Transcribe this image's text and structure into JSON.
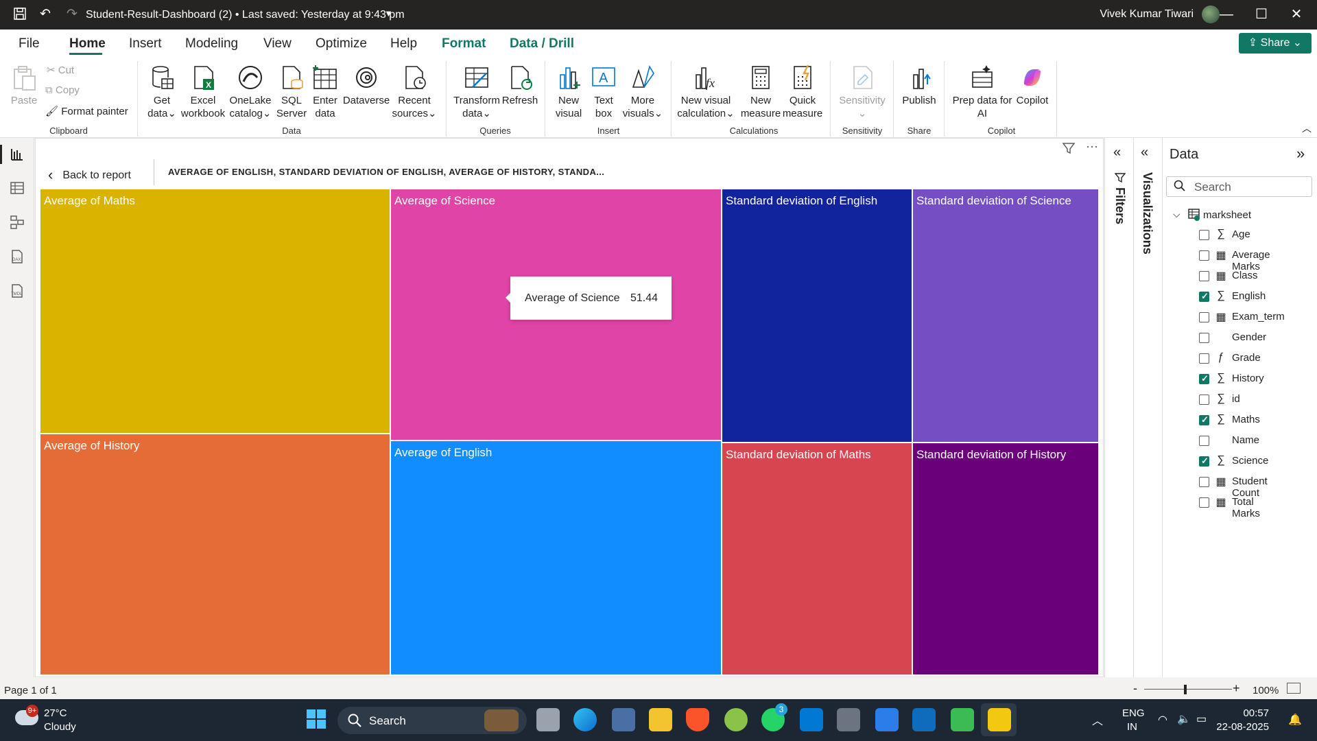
{
  "titlebar": {
    "title": "Student-Result-Dashboard (2) • Last saved: Yesterday at 9:43 pm",
    "user": "Vivek Kumar Tiwari"
  },
  "menu": {
    "tabs": [
      "File",
      "Home",
      "Insert",
      "Modeling",
      "View",
      "Optimize",
      "Help",
      "Format",
      "Data / Drill"
    ],
    "active": "Home",
    "share": "Share"
  },
  "ribbon": {
    "clipboard": {
      "paste": "Paste",
      "cut": "Cut",
      "copy": "Copy",
      "format_painter": "Format painter",
      "label": "Clipboard"
    },
    "data": {
      "get_data": "Get data",
      "excel": "Excel workbook",
      "onelake": "OneLake catalog",
      "sql": "SQL Server",
      "enter": "Enter data",
      "dataverse": "Dataverse",
      "recent": "Recent sources",
      "label": "Data"
    },
    "queries": {
      "transform": "Transform data",
      "refresh": "Refresh",
      "label": "Queries"
    },
    "insert": {
      "new_visual": "New visual",
      "text_box": "Text box",
      "more_visuals": "More visuals",
      "label": "Insert"
    },
    "calculations": {
      "new_visual_calc": "New visual calculation",
      "new_measure": "New measure",
      "quick_measure": "Quick measure",
      "label": "Calculations"
    },
    "sensitivity": {
      "sensitivity": "Sensitivity",
      "label": "Sensitivity"
    },
    "share": {
      "publish": "Publish",
      "label": "Share"
    },
    "copilot": {
      "prep": "Prep data for AI",
      "copilot": "Copilot",
      "label": "Copilot"
    }
  },
  "report": {
    "back": "Back to report",
    "title": "AVERAGE OF ENGLISH, STANDARD DEVIATION OF ENGLISH, AVERAGE OF HISTORY, STANDA..."
  },
  "treemap": {
    "tiles": [
      {
        "label": "Average of Maths",
        "color": "#d9b300"
      },
      {
        "label": "Average of History",
        "color": "#e66c37"
      },
      {
        "label": "Average of Science",
        "color": "#e044a7"
      },
      {
        "label": "Average of English",
        "color": "#118dff"
      },
      {
        "label": "Standard deviation of English",
        "color": "#12239e"
      },
      {
        "label": "Standard deviation of Maths",
        "color": "#d64550"
      },
      {
        "label": "Standard deviation of Science",
        "color": "#744ec2"
      },
      {
        "label": "Standard deviation of History",
        "color": "#6b007b"
      }
    ],
    "tooltip": {
      "label": "Average of Science",
      "value": "51.44"
    }
  },
  "panes": {
    "filters": "Filters",
    "visualizations": "Visualizations",
    "data_title": "Data",
    "search_placeholder": "Search",
    "table": "marksheet",
    "fields": [
      {
        "name": "Age",
        "type": "sigma",
        "checked": false
      },
      {
        "name": "Average Marks",
        "type": "calc",
        "checked": false
      },
      {
        "name": "Class",
        "type": "calc",
        "checked": false
      },
      {
        "name": "English",
        "type": "sigma",
        "checked": true
      },
      {
        "name": "Exam_term",
        "type": "calc",
        "checked": false
      },
      {
        "name": "Gender",
        "type": "none",
        "checked": false
      },
      {
        "name": "Grade",
        "type": "fx",
        "checked": false
      },
      {
        "name": "History",
        "type": "sigma",
        "checked": true
      },
      {
        "name": "id",
        "type": "sigma",
        "checked": false
      },
      {
        "name": "Maths",
        "type": "sigma",
        "checked": true
      },
      {
        "name": "Name",
        "type": "none",
        "checked": false
      },
      {
        "name": "Science",
        "type": "sigma",
        "checked": true
      },
      {
        "name": "Student Count",
        "type": "calc",
        "checked": false
      },
      {
        "name": "Total Marks",
        "type": "calc",
        "checked": false
      }
    ]
  },
  "status": {
    "page": "Page 1 of 1",
    "zoom": "100%"
  },
  "taskbar": {
    "weather_temp": "27°C",
    "weather_desc": "Cloudy",
    "weather_badge": "9+",
    "search": "Search",
    "whatsapp_badge": "3",
    "lang1": "ENG",
    "lang2": "IN",
    "time": "00:57",
    "date": "22-08-2025"
  }
}
